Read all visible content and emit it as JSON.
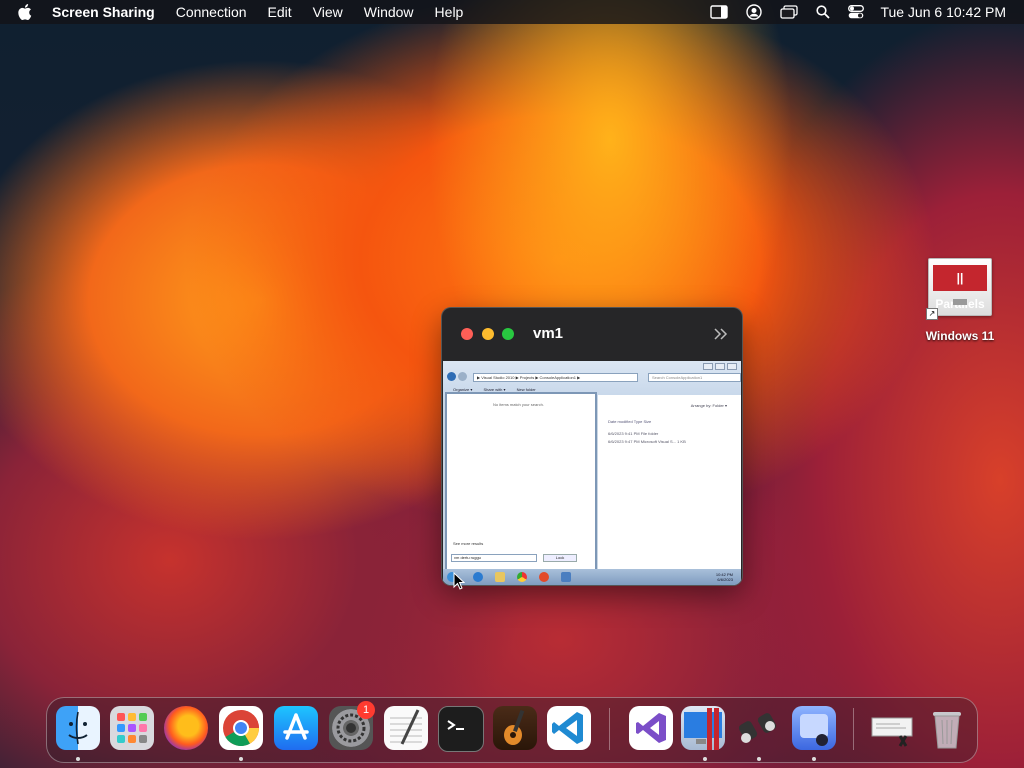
{
  "menubar": {
    "app_name": "Screen Sharing",
    "menus": [
      "Connection",
      "Edit",
      "View",
      "Window",
      "Help"
    ],
    "status_icons": [
      "sidebar-icon",
      "user-icon",
      "windows-icon",
      "search-icon",
      "control-center-icon"
    ],
    "clock": "Tue Jun 6  10:42 PM"
  },
  "window": {
    "title": "vm1",
    "remote": {
      "address": "▶ Visual Studio 2010 ▶ Projects ▶ ConsoleApplication1 ▶",
      "search_placeholder": "Search ConsoleApplication1",
      "toolbar": [
        "Organize ▾",
        "Share with ▾",
        "New folder"
      ],
      "start_menu": {
        "no_items": "No items match your search.",
        "see_more": "See more results",
        "search_value": "vm dertu ruggu",
        "lock_label": "Lock"
      },
      "file_pane": {
        "arrange": "Arrange by:  Folder ▾",
        "headers": "Date modified        Type             Size",
        "rows": [
          "6/6/2023 9:41 PM       File folder",
          "6/6/2023 9:47 PM       Microsoft Visual S...        1 KB"
        ]
      },
      "taskbar_time": "10:42 PM",
      "taskbar_date": "6/6/2023"
    }
  },
  "desktop_icon": {
    "label": "Windows 11",
    "logo_text": "|| Parallels"
  },
  "dock": {
    "apps": [
      "Finder",
      "Launchpad",
      "Firefox",
      "Chrome",
      "App Store",
      "System Settings",
      "TextEdit",
      "Terminal",
      "GarageBand",
      "Visual Studio Code",
      "Visual Studio",
      "Parallels Desktop",
      "Screen Sharing Helper",
      "Preview",
      "Downloads",
      "Trash"
    ],
    "badge_system_settings": "1"
  }
}
